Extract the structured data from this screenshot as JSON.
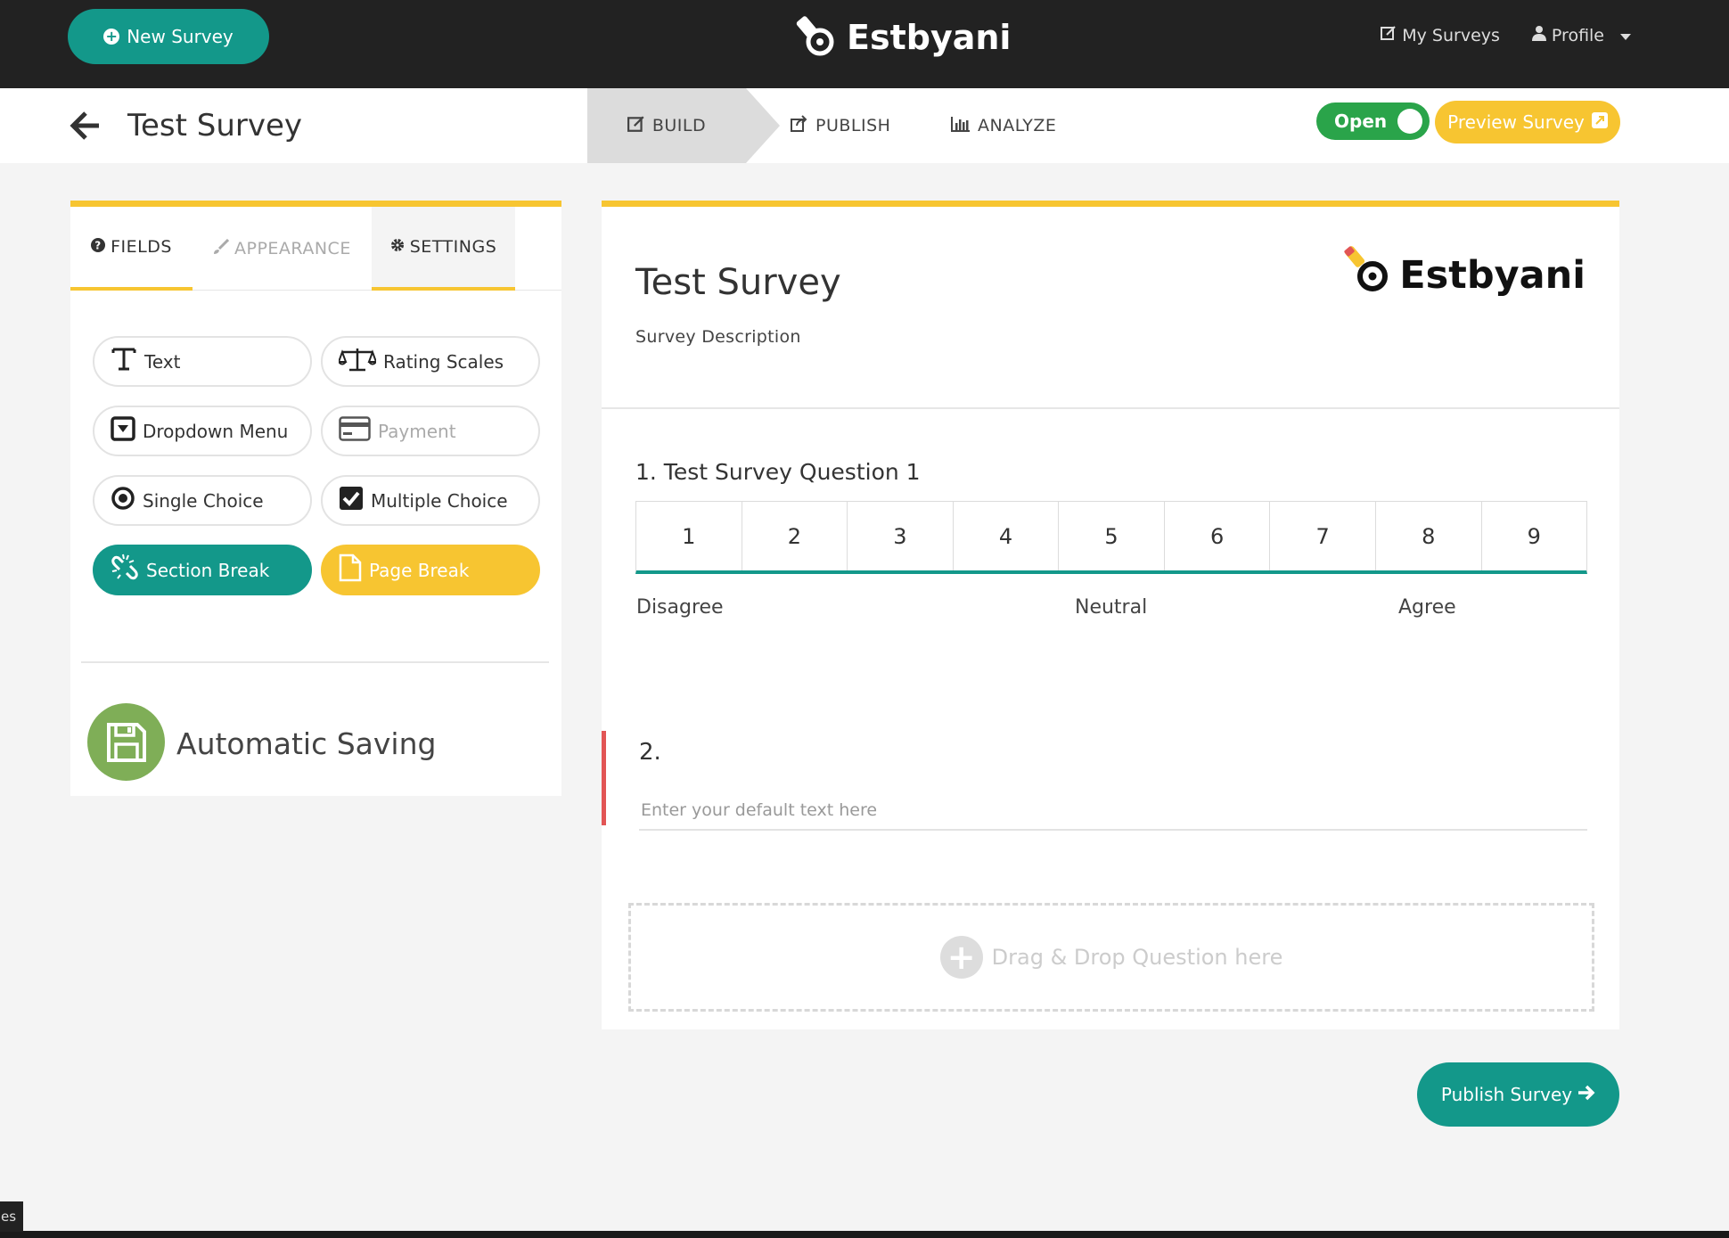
{
  "topbar": {
    "new_survey_label": "New Survey",
    "brand_name": "Estbyani",
    "nav": [
      {
        "label": "My Surveys",
        "icon": "edit-icon"
      },
      {
        "label": "Profile",
        "icon": "user-icon"
      }
    ]
  },
  "subheader": {
    "survey_title": "Test Survey",
    "steps": {
      "build": "BUILD",
      "publish": "PUBLISH",
      "analyze": "ANALYZE"
    },
    "open_toggle": "Open",
    "preview_label": "Preview Survey"
  },
  "left_panel": {
    "tabs": {
      "fields": "FIELDS",
      "appearance": "APPEARANCE",
      "settings": "SETTINGS"
    },
    "fields": {
      "text": "Text",
      "rating_scales": "Rating Scales",
      "dropdown_menu": "Dropdown Menu",
      "payment": "Payment",
      "single_choice": "Single Choice",
      "multiple_choice": "Multiple Choice",
      "section_break": "Section Break",
      "page_break": "Page Break"
    },
    "autosave_label": "Automatic Saving"
  },
  "survey": {
    "title": "Test Survey",
    "description": "Survey Description",
    "logo_text": "Estbyani",
    "q1": {
      "label": "1. Test Survey Question 1",
      "scale": [
        "1",
        "2",
        "3",
        "4",
        "5",
        "6",
        "7",
        "8",
        "9"
      ],
      "anchors": {
        "low": "Disagree",
        "mid": "Neutral",
        "high": "Agree"
      }
    },
    "q2": {
      "label": "2.",
      "placeholder": "Enter your default text here"
    },
    "dropzone_label": "Drag & Drop Question here"
  },
  "publish_label": "Publish Survey",
  "corner_tag": "es",
  "colors": {
    "teal": "#13988a",
    "yellow": "#f7c531",
    "green": "#2aa44a",
    "autosave_green": "#7fae57",
    "dark": "#222222",
    "question_marker": "#e25555"
  }
}
